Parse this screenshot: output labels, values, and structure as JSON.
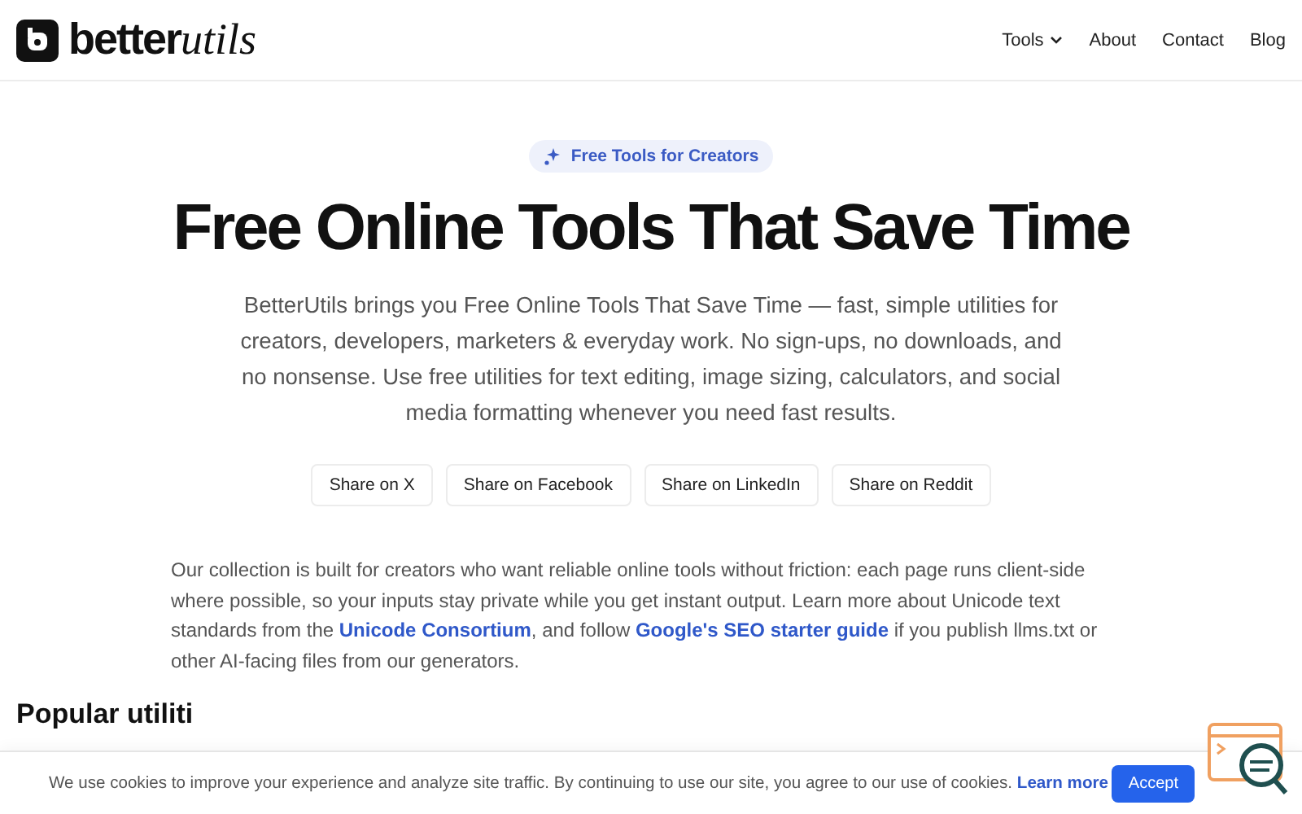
{
  "header": {
    "logo": {
      "word": "better",
      "italic": "utils"
    },
    "nav": [
      {
        "label": "Tools",
        "dropdown": true
      },
      {
        "label": "About",
        "dropdown": false
      },
      {
        "label": "Contact",
        "dropdown": false
      },
      {
        "label": "Blog",
        "dropdown": false
      }
    ]
  },
  "hero": {
    "badge": "Free Tools for Creators",
    "title": "Free Online Tools That Save Time",
    "subtitle": "BetterUtils brings you Free Online Tools That Save Time — fast, simple utilities for creators, developers, marketers & everyday work. No sign-ups, no downloads, and no nonsense. Use free utilities for text editing, image sizing, calculators, and social media formatting whenever you need fast results.",
    "share_buttons": [
      "Share on X",
      "Share on Facebook",
      "Share on LinkedIn",
      "Share on Reddit"
    ]
  },
  "intro": [
    {
      "kind": "text",
      "text": "Our collection is built for creators who want reliable online tools without friction: each page runs client-side where possible, so your inputs stay private while you get instant output. Learn more about Unicode text standards from the "
    },
    {
      "kind": "link",
      "text": "Unicode Consortium"
    },
    {
      "kind": "text",
      "text": ", and follow "
    },
    {
      "kind": "link",
      "text": "Google's SEO starter guide"
    },
    {
      "kind": "text",
      "text": " if you publish llms.txt or other AI-facing files from our generators."
    }
  ],
  "section_heading": "Popular utiliti",
  "cookie_banner": {
    "message": "We use cookies to improve your experience and analyze site traffic. By continuing to use our site, you agree to our use of cookies.",
    "link": "Learn more",
    "button": "Accept"
  }
}
